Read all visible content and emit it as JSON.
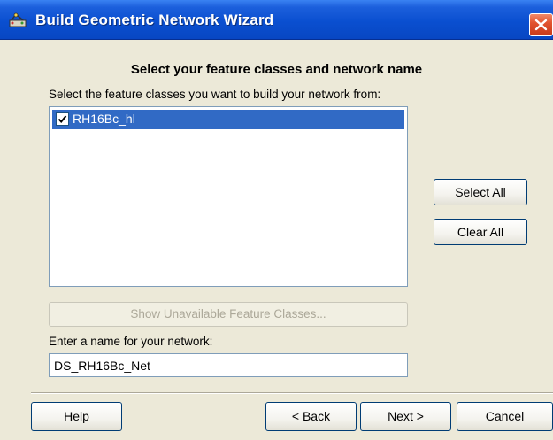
{
  "window": {
    "title": "Build Geometric Network Wizard",
    "icon": "network-wizard-icon",
    "close_icon": "close-icon",
    "accent_color": "#0a4fd0",
    "close_color": "#e2542f"
  },
  "main": {
    "heading": "Select your feature classes and network name",
    "instruction": "Select the feature classes you want to build your network from:",
    "feature_classes": [
      {
        "label": "RH16Bc_hl",
        "checked": true,
        "selected": true
      }
    ],
    "select_all_label": "Select All",
    "clear_all_label": "Clear All",
    "show_unavailable_label": "Show Unavailable Feature Classes...",
    "network_name_label": "Enter a name for your network:",
    "network_name_value": "DS_RH16Bc_Net"
  },
  "footer": {
    "help_label": "Help",
    "back_label": "< Back",
    "next_label": "Next >",
    "cancel_label": "Cancel"
  }
}
